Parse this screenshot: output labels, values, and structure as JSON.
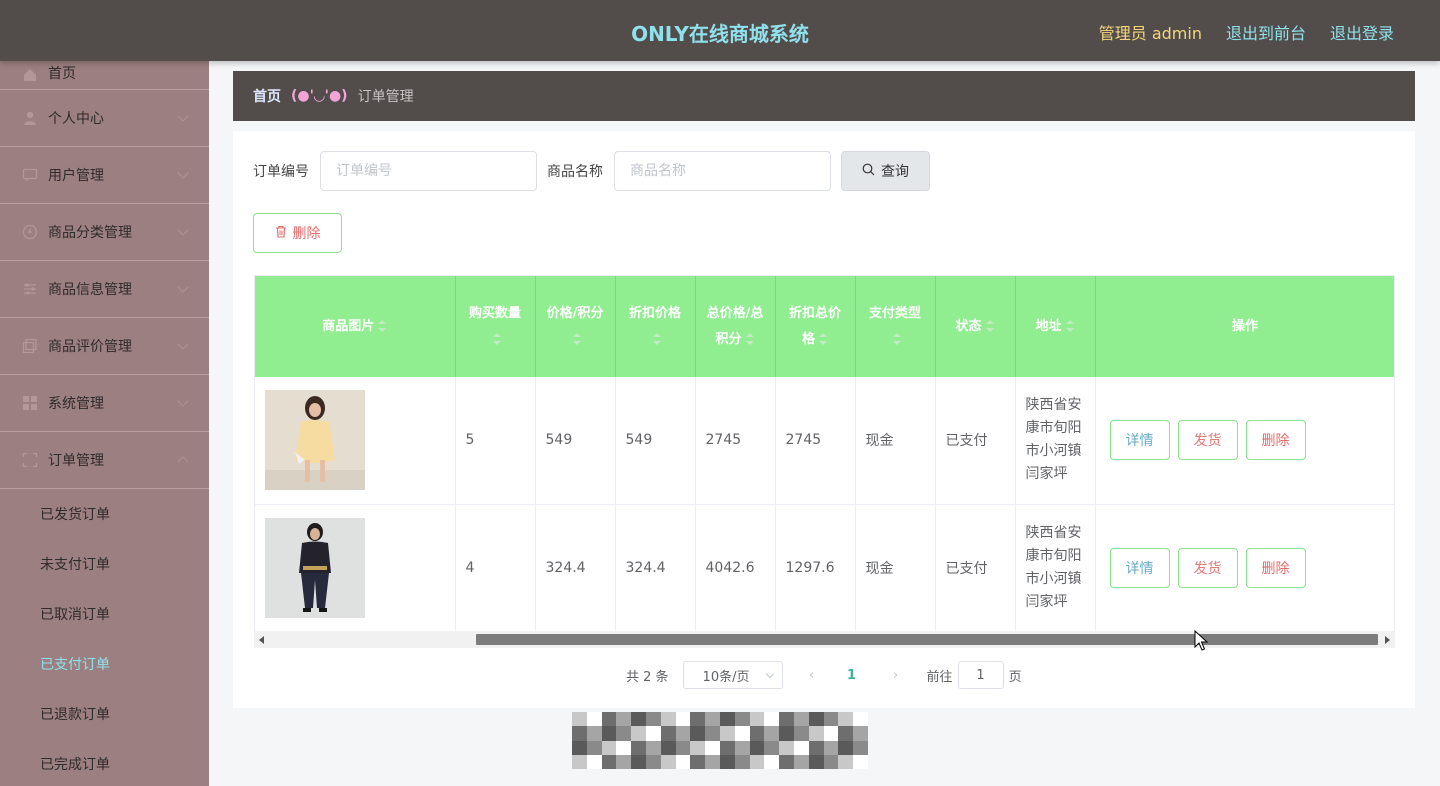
{
  "header": {
    "title": "ONLY在线商城系统",
    "admin": "管理员 admin",
    "to_front": "退出到前台",
    "logout": "退出登录"
  },
  "sidebar": {
    "items": [
      {
        "label": "首页",
        "icon": "home-icon"
      },
      {
        "label": "个人中心",
        "icon": "user-icon"
      },
      {
        "label": "用户管理",
        "icon": "chat-icon"
      },
      {
        "label": "商品分类管理",
        "icon": "compass-icon"
      },
      {
        "label": "商品信息管理",
        "icon": "sliders-icon"
      },
      {
        "label": "商品评价管理",
        "icon": "copy-icon"
      },
      {
        "label": "系统管理",
        "icon": "grid-icon"
      },
      {
        "label": "订单管理",
        "icon": "expand-icon"
      }
    ],
    "sub_items": [
      "已发货订单",
      "未支付订单",
      "已取消订单",
      "已支付订单",
      "已退款订单",
      "已完成订单"
    ],
    "active_sub": "已支付订单"
  },
  "breadcrumb": {
    "home": "首页",
    "sep": "(●'◡'●)",
    "current": "订单管理"
  },
  "search": {
    "order_no_label": "订单编号",
    "order_no_placeholder": "订单编号",
    "product_name_label": "商品名称",
    "product_name_placeholder": "商品名称",
    "query_button": "查询"
  },
  "toolbar": {
    "delete_label": "删除"
  },
  "table": {
    "columns": [
      "商品图片",
      "购买数量",
      "价格/积分",
      "折扣价格",
      "总价格/总积分",
      "折扣总价格",
      "支付类型",
      "状态",
      "地址",
      "操作"
    ],
    "rows": [
      {
        "qty": "5",
        "price": "549",
        "discount_price": "549",
        "total": "2745",
        "discount_total": "2745",
        "pay_type": "现金",
        "status": "已支付",
        "address": "陕西省安康市旬阳市小河镇闫家坪",
        "image": "product-yellow-dress"
      },
      {
        "qty": "4",
        "price": "324.4",
        "discount_price": "324.4",
        "total": "4042.6",
        "discount_total": "1297.6",
        "pay_type": "现金",
        "status": "已支付",
        "address": "陕西省安康市旬阳市小河镇闫家坪",
        "image": "product-black-suit"
      }
    ],
    "actions": {
      "detail": "详情",
      "ship": "发货",
      "delete": "删除"
    }
  },
  "pagination": {
    "total": "共 2 条",
    "page_size": "10条/页",
    "current_page": "1",
    "goto_prefix": "前往",
    "goto_value": "1",
    "goto_suffix": "页"
  },
  "colors": {
    "header_bg": "#524c4b",
    "sidebar_bg": "#9c7f80",
    "table_header_bg": "#90ee90",
    "title_color": "#8fe1ec",
    "admin_color": "#f3d779"
  }
}
